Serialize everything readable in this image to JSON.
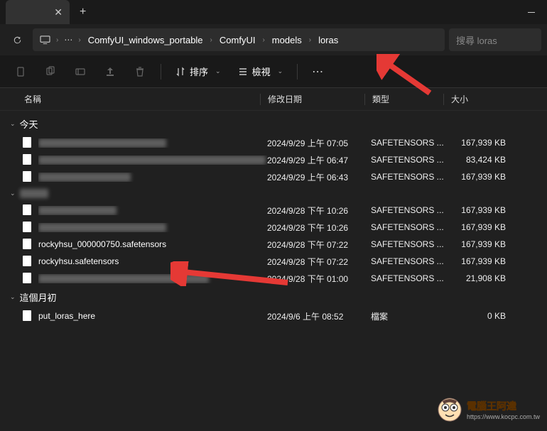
{
  "breadcrumb": {
    "items": [
      "ComfyUI_windows_portable",
      "ComfyUI",
      "models",
      "loras"
    ]
  },
  "search": {
    "placeholder": "搜尋 loras"
  },
  "toolbar": {
    "sort": "排序",
    "view": "檢視"
  },
  "columns": {
    "name": "名稱",
    "date": "修改日期",
    "type": "類型",
    "size": "大小"
  },
  "groups": [
    {
      "label": "今天",
      "rows": [
        {
          "name": "████████████████",
          "blur": true,
          "date": "2024/9/29 上午 07:05",
          "type": "SAFETENSORS ...",
          "size": "167,939 KB",
          "nameWidth": 180
        },
        {
          "name": "████████████████████████████████",
          "blur": true,
          "date": "2024/9/29 上午 06:47",
          "type": "SAFETENSORS ...",
          "size": "83,424 KB",
          "nameWidth": 320
        },
        {
          "name": "███████████████",
          "blur": true,
          "date": "2024/9/29 上午 06:43",
          "type": "SAFETENSORS ...",
          "size": "167,939 KB",
          "nameWidth": 130
        }
      ]
    },
    {
      "label": "████",
      "blur": true,
      "rows": [
        {
          "name": "████████████",
          "blur": true,
          "date": "2024/9/28 下午 10:26",
          "type": "SAFETENSORS ...",
          "size": "167,939 KB",
          "nameWidth": 110
        },
        {
          "name": "██████████████████",
          "blur": true,
          "date": "2024/9/28 下午 10:26",
          "type": "SAFETENSORS ...",
          "size": "167,939 KB",
          "nameWidth": 180
        },
        {
          "name": "rockyhsu_000000750.safetensors",
          "blur": false,
          "date": "2024/9/28 下午 07:22",
          "type": "SAFETENSORS ...",
          "size": "167,939 KB"
        },
        {
          "name": "rockyhsu.safetensors",
          "blur": false,
          "date": "2024/9/28 下午 07:22",
          "type": "SAFETENSORS ...",
          "size": "167,939 KB"
        },
        {
          "name": "█████████████████████████",
          "blur": true,
          "date": "2024/9/28 下午 01:00",
          "type": "SAFETENSORS ...",
          "size": "21,908 KB",
          "nameWidth": 240
        }
      ]
    },
    {
      "label": "這個月初",
      "rows": [
        {
          "name": "put_loras_here",
          "blur": false,
          "date": "2024/9/6 上午 08:52",
          "type": "檔案",
          "size": "0 KB"
        }
      ]
    }
  ],
  "watermark": {
    "title": "電腦王阿達",
    "url": "https://www.kocpc.com.tw"
  }
}
